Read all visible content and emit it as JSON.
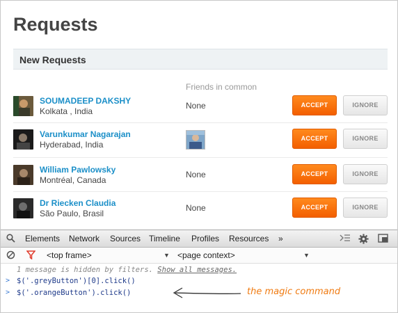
{
  "page": {
    "title": "Requests"
  },
  "section": {
    "title": "New Requests",
    "column_header": "Friends in common"
  },
  "buttons": {
    "accept": "ACCEPT",
    "ignore": "IGNORE"
  },
  "requests": [
    {
      "name": "SOUMADEEP DAKSHY",
      "location": "Kolkata , India",
      "common": "None"
    },
    {
      "name": "Varunkumar Nagarajan",
      "location": "Hyderabad, India",
      "common": ""
    },
    {
      "name": "William Pawlowsky",
      "location": "Montréal, Canada",
      "common": "None"
    },
    {
      "name": "Dr Riecken Claudia",
      "location": "São Paulo, Brasil",
      "common": "None"
    }
  ],
  "devtools": {
    "tabs": [
      "Elements",
      "Network",
      "Sources",
      "Timeline",
      "Profiles",
      "Resources",
      "»"
    ],
    "frame_select": "<top frame>",
    "context_select": "<page context>",
    "hidden_message_prefix": "1 message is hidden by filters. ",
    "hidden_message_link": "Show all messages.",
    "commands": [
      "$('.greyButton')[0].click()",
      "$('.orangeButton').click()"
    ],
    "prompt": ">"
  },
  "annotation": "the magic command",
  "colors": {
    "accent_orange": "#f47200",
    "link_blue": "#1b8fc8",
    "annotation": "#f07b12"
  }
}
